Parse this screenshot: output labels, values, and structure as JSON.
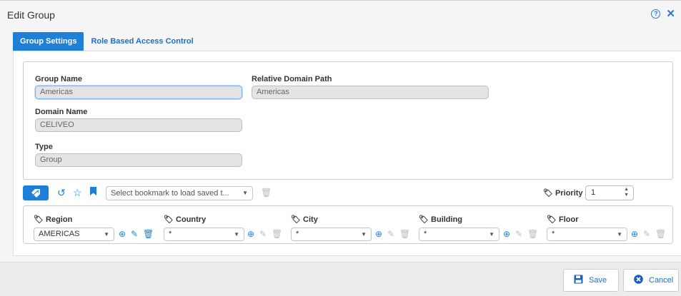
{
  "window": {
    "title": "Edit Group"
  },
  "tabs": [
    {
      "label": "Group Settings"
    },
    {
      "label": "Role Based Access Control"
    }
  ],
  "form": {
    "group_name": {
      "label": "Group Name",
      "value": "Americas"
    },
    "relative_domain_path": {
      "label": "Relative Domain Path",
      "value": "Americas"
    },
    "domain_name": {
      "label": "Domain Name",
      "value": "CELIVEO"
    },
    "type": {
      "label": "Type",
      "value": "Group"
    }
  },
  "toolbar": {
    "bookmark_select": "Select bookmark to load saved t...",
    "priority_label": "Priority",
    "priority_value": "1"
  },
  "filters": [
    {
      "label": "Region",
      "value": "AMERICAS",
      "actions_enabled": true
    },
    {
      "label": "Country",
      "value": "*",
      "actions_enabled": false
    },
    {
      "label": "City",
      "value": "*",
      "actions_enabled": false
    },
    {
      "label": "Building",
      "value": "*",
      "actions_enabled": false
    },
    {
      "label": "Floor",
      "value": "*",
      "actions_enabled": false
    }
  ],
  "footer": {
    "save_label": "Save",
    "cancel_label": "Cancel"
  },
  "colors": {
    "accent": "#1e7fd6"
  }
}
